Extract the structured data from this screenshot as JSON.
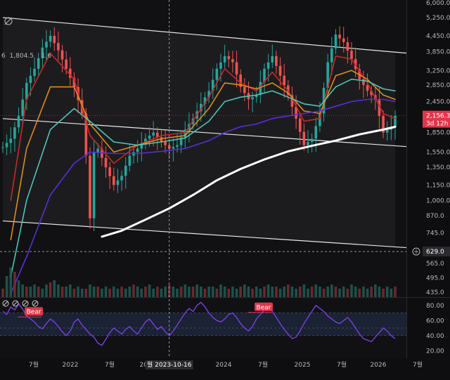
{
  "chart_data": {
    "type": "candlestick",
    "price_axis": {
      "scale": "log",
      "ticks": [
        "6,000.0",
        "5,250.0",
        "4,450.0",
        "3,850.0",
        "3,250.0",
        "2,850.0",
        "2,450.0",
        "1,850.0",
        "1,550.0",
        "1,350.0",
        "1,150.0",
        "1,000.0",
        "870.0",
        "745.0",
        "565.0",
        "495.0",
        "435.0"
      ],
      "tick_values": [
        6000,
        5250,
        4450,
        3850,
        3250,
        2850,
        2450,
        1850,
        1550,
        1350,
        1150,
        1000,
        870,
        745,
        565,
        495,
        435
      ],
      "range": [
        420,
        6000
      ]
    },
    "time_axis": {
      "ticks": [
        "7월",
        "2022",
        "7월",
        "2023",
        "7월",
        "2024",
        "7월",
        "2025",
        "7월",
        "2026",
        "7월"
      ],
      "crosshair_label": "월 2023-10-16"
    },
    "last_price": {
      "value": "2,156.3",
      "countdown": "3d 12h",
      "color": "#e0364a"
    },
    "crosshair_price": {
      "value": "629.0"
    },
    "ma_legend": [
      "6",
      "1,804.5",
      "1,6"
    ],
    "series": [
      {
        "kind": "price",
        "points": [
          [
            0,
            1620
          ],
          [
            2,
            1750
          ],
          [
            4,
            2150
          ],
          [
            6,
            2900
          ],
          [
            8,
            3300
          ],
          [
            10,
            4000
          ],
          [
            12,
            4450
          ],
          [
            14,
            3900
          ],
          [
            16,
            3300
          ],
          [
            18,
            2800
          ],
          [
            20,
            2200
          ],
          [
            21,
            1500
          ],
          [
            22,
            850
          ],
          [
            23,
            1550
          ],
          [
            24,
            1600
          ],
          [
            26,
            1350
          ],
          [
            28,
            1150
          ],
          [
            30,
            1250
          ],
          [
            32,
            1500
          ],
          [
            34,
            1600
          ],
          [
            36,
            1750
          ],
          [
            38,
            1850
          ],
          [
            40,
            1700
          ],
          [
            42,
            1600
          ],
          [
            44,
            1650
          ],
          [
            46,
            1900
          ],
          [
            48,
            2100
          ],
          [
            50,
            2400
          ],
          [
            52,
            2700
          ],
          [
            54,
            3300
          ],
          [
            56,
            3700
          ],
          [
            58,
            3500
          ],
          [
            60,
            2800
          ],
          [
            62,
            2500
          ],
          [
            64,
            2600
          ],
          [
            66,
            3300
          ],
          [
            68,
            3700
          ],
          [
            70,
            3100
          ],
          [
            72,
            2600
          ],
          [
            74,
            2100
          ],
          [
            76,
            1650
          ],
          [
            78,
            1750
          ],
          [
            80,
            2200
          ],
          [
            82,
            3500
          ],
          [
            84,
            4500
          ],
          [
            86,
            4200
          ],
          [
            88,
            3600
          ],
          [
            90,
            3000
          ],
          [
            92,
            2700
          ],
          [
            94,
            2500
          ],
          [
            96,
            1850
          ],
          [
            98,
            1950
          ],
          [
            99,
            2156
          ]
        ]
      },
      {
        "kind": "ema",
        "color": "#c62828",
        "points": [
          [
            2,
            1000
          ],
          [
            6,
            2500
          ],
          [
            12,
            3800
          ],
          [
            18,
            3000
          ],
          [
            22,
            1800
          ],
          [
            28,
            1400
          ],
          [
            34,
            1650
          ],
          [
            40,
            1800
          ],
          [
            46,
            1850
          ],
          [
            52,
            2550
          ],
          [
            56,
            3300
          ],
          [
            60,
            2900
          ],
          [
            64,
            2700
          ],
          [
            68,
            3200
          ],
          [
            72,
            2700
          ],
          [
            76,
            2050
          ],
          [
            80,
            2100
          ],
          [
            84,
            3700
          ],
          [
            88,
            3600
          ],
          [
            92,
            2900
          ],
          [
            96,
            2200
          ],
          [
            99,
            2100
          ]
        ]
      },
      {
        "kind": "ema",
        "color": "#e08a1e",
        "points": [
          [
            2,
            700
          ],
          [
            6,
            1600
          ],
          [
            12,
            2800
          ],
          [
            18,
            2800
          ],
          [
            22,
            2000
          ],
          [
            28,
            1550
          ],
          [
            34,
            1650
          ],
          [
            40,
            1750
          ],
          [
            46,
            1800
          ],
          [
            52,
            2300
          ],
          [
            56,
            2900
          ],
          [
            60,
            2850
          ],
          [
            64,
            2750
          ],
          [
            68,
            2900
          ],
          [
            72,
            2650
          ],
          [
            76,
            2250
          ],
          [
            80,
            2200
          ],
          [
            84,
            3100
          ],
          [
            88,
            3250
          ],
          [
            92,
            3000
          ],
          [
            96,
            2600
          ],
          [
            99,
            2500
          ]
        ]
      },
      {
        "kind": "ema",
        "color": "#4ec4b4",
        "points": [
          [
            2,
            500
          ],
          [
            6,
            1000
          ],
          [
            12,
            1900
          ],
          [
            18,
            2300
          ],
          [
            22,
            2050
          ],
          [
            28,
            1700
          ],
          [
            34,
            1650
          ],
          [
            40,
            1700
          ],
          [
            46,
            1760
          ],
          [
            52,
            2050
          ],
          [
            56,
            2450
          ],
          [
            60,
            2550
          ],
          [
            64,
            2600
          ],
          [
            68,
            2700
          ],
          [
            72,
            2550
          ],
          [
            76,
            2400
          ],
          [
            80,
            2350
          ],
          [
            84,
            2800
          ],
          [
            88,
            3000
          ],
          [
            92,
            2950
          ],
          [
            96,
            2750
          ],
          [
            99,
            2700
          ]
        ]
      },
      {
        "kind": "ema",
        "color": "#5a2fd6",
        "points": [
          [
            2,
            430
          ],
          [
            6,
            600
          ],
          [
            12,
            1050
          ],
          [
            18,
            1400
          ],
          [
            22,
            1550
          ],
          [
            28,
            1530
          ],
          [
            34,
            1530
          ],
          [
            40,
            1560
          ],
          [
            46,
            1600
          ],
          [
            52,
            1720
          ],
          [
            56,
            1850
          ],
          [
            60,
            1950
          ],
          [
            64,
            2000
          ],
          [
            68,
            2100
          ],
          [
            72,
            2150
          ],
          [
            76,
            2200
          ],
          [
            80,
            2250
          ],
          [
            84,
            2350
          ],
          [
            88,
            2450
          ],
          [
            92,
            2500
          ],
          [
            96,
            2500
          ],
          [
            99,
            2450
          ]
        ]
      },
      {
        "kind": "ema",
        "color": "#ffffff",
        "points": [
          [
            25,
            720
          ],
          [
            30,
            760
          ],
          [
            36,
            840
          ],
          [
            42,
            930
          ],
          [
            48,
            1050
          ],
          [
            54,
            1200
          ],
          [
            60,
            1330
          ],
          [
            66,
            1450
          ],
          [
            72,
            1560
          ],
          [
            78,
            1640
          ],
          [
            84,
            1720
          ],
          [
            90,
            1820
          ],
          [
            96,
            1900
          ],
          [
            99,
            1950
          ]
        ]
      }
    ],
    "channel_lines": [
      {
        "from": [
          0,
          5250
        ],
        "to": [
          99,
          3850
        ]
      },
      {
        "from": [
          0,
          2100
        ],
        "to": [
          99,
          1650
        ]
      },
      {
        "from": [
          0,
          830
        ],
        "to": [
          99,
          660
        ]
      }
    ],
    "crosshair_time": 42,
    "volume": [
      4,
      10,
      14,
      12,
      8,
      6,
      5,
      5,
      6,
      5,
      4,
      6,
      7,
      8,
      6,
      5,
      5,
      6,
      4,
      5,
      4,
      4,
      6,
      5,
      5,
      4,
      5,
      4,
      5,
      4,
      5,
      4,
      5,
      6,
      5,
      4,
      5,
      6,
      4,
      5,
      4,
      5,
      6,
      5,
      4,
      5,
      6,
      5,
      5,
      6,
      5,
      4,
      5,
      5,
      4,
      6,
      5,
      4,
      5,
      4,
      5,
      6,
      5,
      4,
      5,
      4,
      5,
      6,
      5,
      5,
      4,
      5,
      6,
      5,
      4,
      5,
      6,
      4,
      5,
      6,
      5,
      4,
      5,
      6,
      5,
      4,
      5,
      4,
      6,
      5,
      4,
      5,
      4,
      5,
      6,
      5,
      4,
      5,
      4,
      5
    ],
    "rsi": {
      "axis_ticks": [
        "80.00",
        "60.00",
        "40.00",
        "20.00"
      ],
      "axis_values": [
        80,
        60,
        40,
        20
      ],
      "band": [
        40,
        70
      ],
      "values": [
        72,
        68,
        78,
        74,
        82,
        75,
        66,
        62,
        58,
        52,
        49,
        56,
        62,
        58,
        52,
        45,
        40,
        46,
        58,
        62,
        54,
        48,
        42,
        38,
        30,
        27,
        35,
        44,
        50,
        46,
        42,
        48,
        52,
        46,
        42,
        50,
        58,
        62,
        55,
        48,
        52,
        45,
        40,
        46,
        54,
        62,
        70,
        76,
        72,
        80,
        84,
        78,
        70,
        64,
        60,
        58,
        62,
        68,
        70,
        64,
        56,
        50,
        46,
        52,
        62,
        68,
        74,
        78,
        72,
        64,
        56,
        48,
        42,
        36,
        38,
        46,
        56,
        64,
        72,
        80,
        76,
        72,
        66,
        62,
        58,
        56,
        60,
        64,
        58,
        50,
        42,
        36,
        34,
        32,
        38,
        44,
        50,
        46,
        40,
        36
      ],
      "bear_labels": [
        {
          "text": "Bear",
          "index": 8,
          "level": 74
        },
        {
          "text": "Bear",
          "index": 66,
          "level": 80
        }
      ]
    }
  }
}
